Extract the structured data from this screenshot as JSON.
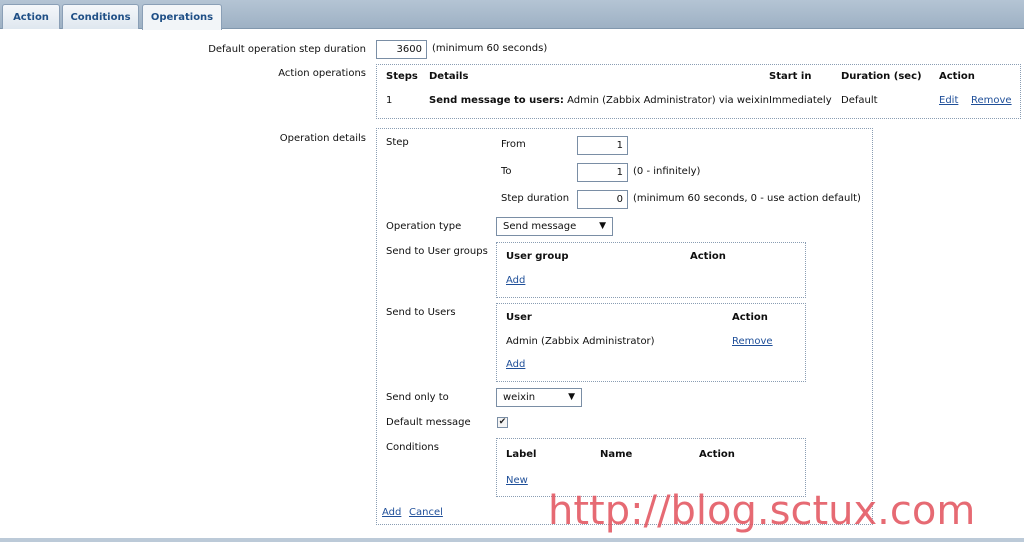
{
  "tabs": [
    {
      "label": "Action"
    },
    {
      "label": "Conditions"
    },
    {
      "label": "Operations"
    }
  ],
  "default_step": {
    "label": "Default operation step duration",
    "value": "3600",
    "hint": "(minimum 60 seconds)"
  },
  "action_operations": {
    "label": "Action operations",
    "headers": {
      "steps": "Steps",
      "details": "Details",
      "start_in": "Start in",
      "duration": "Duration (sec)",
      "action": "Action"
    },
    "rows": [
      {
        "step": "1",
        "details_bold": "Send message to users:",
        "details_rest": "Admin (Zabbix Administrator) via weixin",
        "start_in": "Immediately",
        "duration": "Default",
        "edit": "Edit",
        "remove": "Remove"
      }
    ]
  },
  "operation_details": {
    "label": "Operation details",
    "step_label": "Step",
    "from_label": "From",
    "from_value": "1",
    "to_label": "To",
    "to_value": "1",
    "to_hint": "(0 - infinitely)",
    "step_duration_label": "Step duration",
    "step_duration_value": "0",
    "step_duration_hint": "(minimum 60 seconds, 0 - use action default)",
    "operation_type_label": "Operation type",
    "operation_type_value": "Send message",
    "send_groups_label": "Send to User groups",
    "groups_header_group": "User group",
    "groups_header_action": "Action",
    "groups_add": "Add",
    "send_users_label": "Send to Users",
    "users_header_user": "User",
    "users_header_action": "Action",
    "users_rows": [
      {
        "user": "Admin (Zabbix Administrator)",
        "remove": "Remove"
      }
    ],
    "users_add": "Add",
    "send_only_label": "Send only to",
    "send_only_value": "weixin",
    "default_message_label": "Default message",
    "default_message_checked": true,
    "conditions_label": "Conditions",
    "cond_header_label": "Label",
    "cond_header_name": "Name",
    "cond_header_action": "Action",
    "cond_new": "New",
    "add": "Add",
    "cancel": "Cancel"
  },
  "watermark": "http://blog.sctux.com",
  "icons": {
    "dropdown_arrow": "▼",
    "check": "✔"
  }
}
